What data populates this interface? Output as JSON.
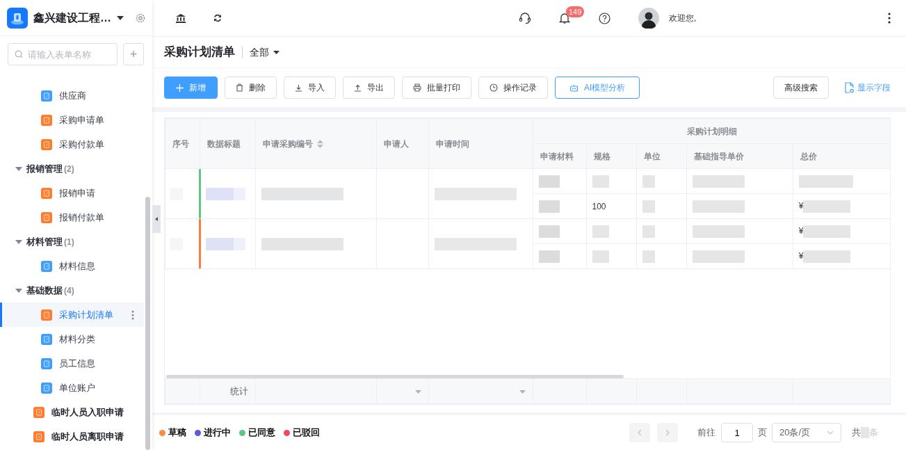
{
  "app": {
    "title": "鑫兴建设工程…"
  },
  "sidebar": {
    "search_placeholder": "请输入表单名称",
    "add_label": "+",
    "tree": [
      {
        "children": [
          {
            "label": "供应商",
            "color": "#409eff",
            "selected": false
          },
          {
            "label": "采购申请单",
            "color": "#ff7d2e",
            "selected": false
          },
          {
            "label": "采购付款单",
            "color": "#ff7d2e",
            "selected": false
          }
        ]
      },
      {
        "label": "报销管理",
        "count": "(2)",
        "expanded": true,
        "children": [
          {
            "label": "报销申请",
            "color": "#ff7d2e",
            "selected": false
          },
          {
            "label": "报销付款单",
            "color": "#ff7d2e",
            "selected": false
          }
        ]
      },
      {
        "label": "材料管理",
        "count": "(1)",
        "expanded": true,
        "children": [
          {
            "label": "材料信息",
            "color": "#409eff",
            "selected": false
          }
        ]
      },
      {
        "label": "基础数据",
        "count": "(4)",
        "expanded": true,
        "children": [
          {
            "label": "采购计划清单",
            "color": "#ff7d2e",
            "selected": true
          },
          {
            "label": "材料分类",
            "color": "#409eff",
            "selected": false
          },
          {
            "label": "员工信息",
            "color": "#409eff",
            "selected": false
          },
          {
            "label": "单位账户",
            "color": "#409eff",
            "selected": false
          }
        ]
      },
      {
        "label": "临时人员入职申请",
        "color": "#ff7d2e",
        "selected": false
      },
      {
        "label": "临时人员离职申请",
        "color": "#ff7d2e",
        "selected": false
      }
    ]
  },
  "header": {
    "notification_count": "149",
    "welcome": "欢迎您,"
  },
  "page": {
    "title": "采购计划清单",
    "filter": "全部"
  },
  "toolbar": {
    "buttons": [
      {
        "label": "新增",
        "kind": "primary"
      },
      {
        "label": "删除",
        "kind": "delete"
      },
      {
        "label": "导入",
        "kind": "import"
      },
      {
        "label": "导出",
        "kind": "export"
      },
      {
        "label": "批量打印",
        "kind": "print"
      },
      {
        "label": "操作记录",
        "kind": "history"
      },
      {
        "label": "AI模型分析",
        "kind": "ai"
      }
    ],
    "advanced_search": "高级搜索",
    "show_fields": "显示字段"
  },
  "table": {
    "columns": [
      {
        "label": "序号",
        "sortable": false
      },
      {
        "label": "数据标题",
        "sortable": false
      },
      {
        "label": "申请采购编号",
        "sortable": true
      },
      {
        "label": "申请人",
        "sortable": false
      },
      {
        "label": "申请时间",
        "sortable": false
      }
    ],
    "group_header": "采购计划明细",
    "detail_columns": [
      "申请材料",
      "规格",
      "单位",
      "基础指导单价",
      "总价"
    ],
    "rows": [
      {
        "color": "#5ec584",
        "details": [
          {
            "kind": "hidden"
          },
          {
            "kind": "priced",
            "spec": "100",
            "total_prefix": "¥"
          }
        ]
      },
      {
        "color": "#ff7d3a",
        "details": [
          {
            "kind": "priced",
            "total_prefix": "¥"
          },
          {
            "kind": "priced",
            "total_prefix": "¥"
          }
        ]
      }
    ],
    "summary_label": "统计"
  },
  "legend": [
    {
      "label": "草稿",
      "color": "#ff8c3a"
    },
    {
      "label": "进行中",
      "color": "#5b5bdb"
    },
    {
      "label": "已同意",
      "color": "#5ec584"
    },
    {
      "label": "已驳回",
      "color": "#f5475b"
    }
  ],
  "pagination": {
    "goto_label": "前往",
    "page": "1",
    "page_suffix": "页",
    "page_size": "20条/页",
    "total_prefix": "共",
    "total_suffix": "条"
  }
}
